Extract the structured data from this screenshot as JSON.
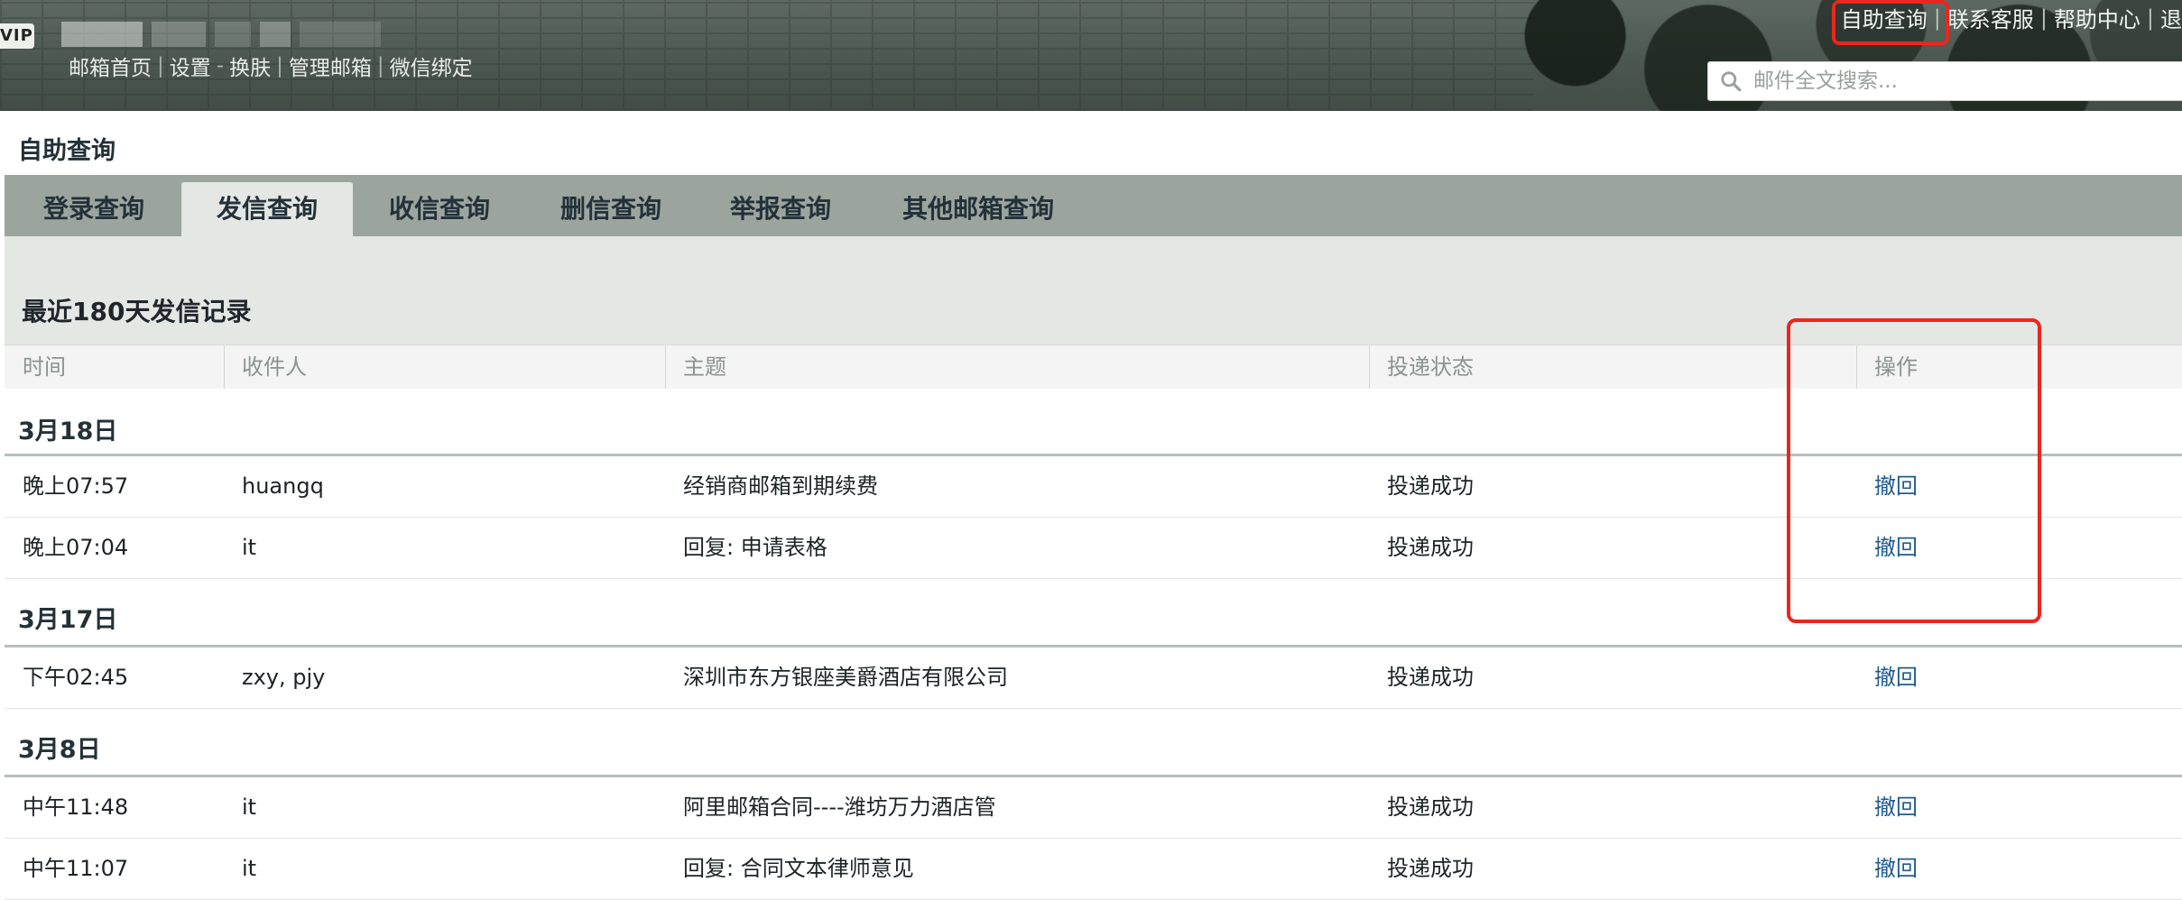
{
  "header": {
    "vip_label": "VIP",
    "nav_links": [
      "邮箱首页",
      "设置",
      "换肤",
      "管理邮箱",
      "微信绑定"
    ],
    "top_links": [
      "自助查询",
      "联系客服",
      "帮助中心",
      "退"
    ],
    "search_placeholder": "邮件全文搜索..."
  },
  "page": {
    "title": "自助查询"
  },
  "tabs": [
    {
      "label": "登录查询",
      "active": false
    },
    {
      "label": "发信查询",
      "active": true
    },
    {
      "label": "收信查询",
      "active": false
    },
    {
      "label": "删信查询",
      "active": false
    },
    {
      "label": "举报查询",
      "active": false
    },
    {
      "label": "其他邮箱查询",
      "active": false
    }
  ],
  "section": {
    "title": "最近180天发信记录"
  },
  "table": {
    "columns": [
      "时间",
      "收件人",
      "主题",
      "投递状态",
      "操作"
    ],
    "groups": [
      {
        "date": "3月18日",
        "rows": [
          {
            "time": "晚上07:57",
            "recipient": "huangq",
            "subject": "经销商邮箱到期续费",
            "status": "投递成功",
            "action": "撤回"
          },
          {
            "time": "晚上07:04",
            "recipient": "it",
            "subject": "回复: 申请表格",
            "status": "投递成功",
            "action": "撤回"
          }
        ]
      },
      {
        "date": "3月17日",
        "rows": [
          {
            "time": "下午02:45",
            "recipient": "zxy, pjy",
            "subject": "深圳市东方银座美爵酒店有限公司",
            "status": "投递成功",
            "action": "撤回"
          }
        ]
      },
      {
        "date": "3月8日",
        "rows": [
          {
            "time": "中午11:48",
            "recipient": "it",
            "subject": "阿里邮箱合同----潍坊万力酒店管",
            "status": "投递成功",
            "action": "撤回"
          },
          {
            "time": "中午11:07",
            "recipient": "it",
            "subject": "回复: 合同文本律师意见",
            "status": "投递成功",
            "action": "撤回"
          }
        ]
      }
    ]
  }
}
